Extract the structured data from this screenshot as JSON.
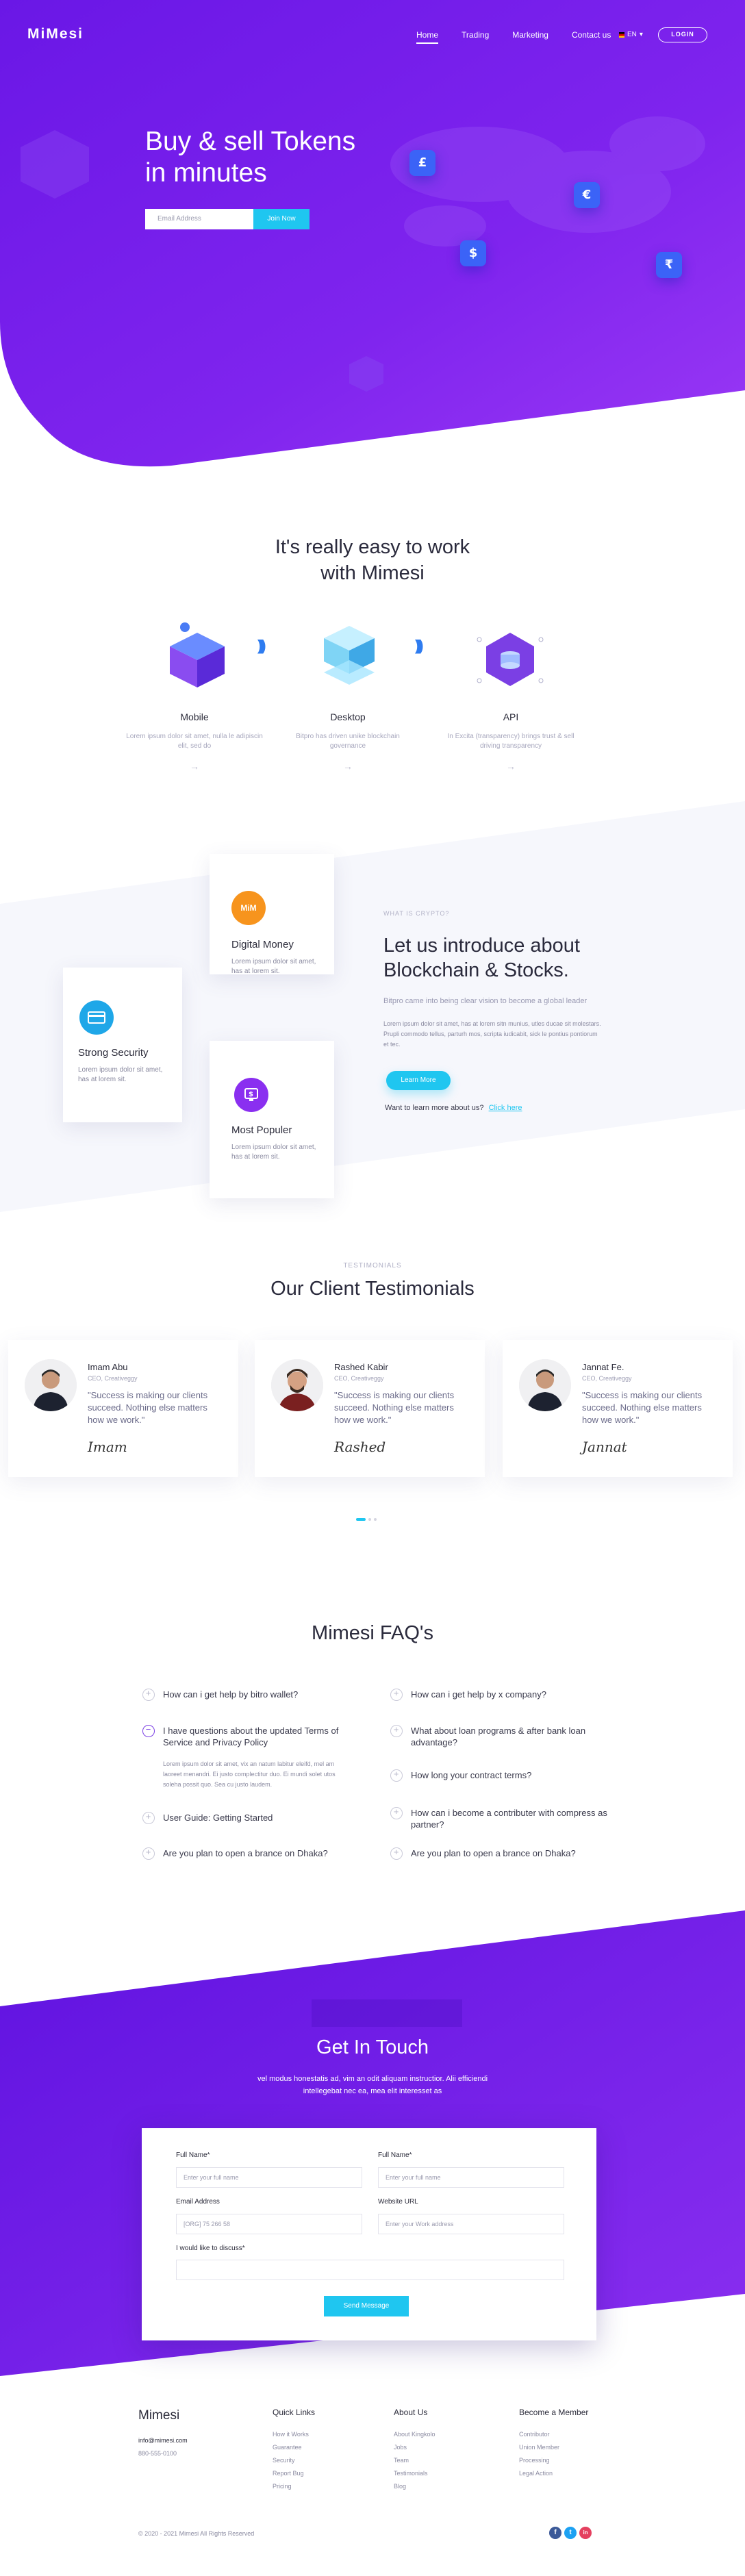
{
  "brand": {
    "logo": "MiMesi"
  },
  "nav": {
    "links": [
      "Home",
      "Trading",
      "Marketing",
      "Contact us"
    ],
    "language": "EN",
    "login": "LOGIN"
  },
  "hero": {
    "title_line1": "Buy & sell Tokens",
    "title_line2": "in minutes",
    "email_placeholder": "Email Address",
    "join_button": "Join Now",
    "coins": [
      "£",
      "€",
      "$",
      "₹"
    ]
  },
  "easy": {
    "title_line1": "It's really easy to work",
    "title_line2": "with Mimesi",
    "features": [
      {
        "name": "Mobile",
        "desc": "Lorem ipsum dolor sit amet, nulla le adipiscin elit, sed do"
      },
      {
        "name": "Desktop",
        "desc": "Bitpro has driven unike blockchain governance"
      },
      {
        "name": "API",
        "desc": "In Excita (transparency) brings trust & sell driving transparency"
      }
    ],
    "arrow": "→"
  },
  "intro": {
    "cards": [
      {
        "badge": "MiM",
        "title": "Digital Money",
        "desc": "Lorem ipsum dolor sit amet, has at lorem sit."
      },
      {
        "badge": "",
        "title": "Strong Security",
        "desc": "Lorem ipsum dolor sit amet, has at lorem sit."
      },
      {
        "badge": "",
        "title": "Most Populer",
        "desc": "Lorem ipsum dolor sit amet, has at lorem sit."
      }
    ],
    "eyebrow": "WHAT IS CRYPTO?",
    "title": "Let us introduce about Blockchain & Stocks.",
    "subtitle": "Bitpro came into being clear vision to become a global leader",
    "body": "Lorem ipsum dolor sit amet, has at lorem sitn munius, utles ducae sit molestars. Prupli commodo tellus, parturh mos, scripta iudicabit, sick le pontius pontiorum et tec.",
    "learn_button": "Learn More",
    "learn_more_text": "Want to learn more about us?",
    "learn_more_link": "Click here"
  },
  "testimonials": {
    "eyebrow": "TESTIMONIALS",
    "title": "Our Client Testimonials",
    "items": [
      {
        "name": "Imam Abu",
        "role": "CEO, Creativeggy",
        "quote": "\"Success is making our clients succeed. Nothing else matters how we work.\"",
        "signature": "Imam"
      },
      {
        "name": "Rashed Kabir",
        "role": "CEO, Creativeggy",
        "quote": "\"Success is making our clients succeed. Nothing else matters how we work.\"",
        "signature": "Rashed"
      },
      {
        "name": "Jannat Fe.",
        "role": "CEO, Creativeggy",
        "quote": "\"Success is making our clients succeed. Nothing else matters how we work.\"",
        "signature": "Jannat"
      }
    ]
  },
  "faq": {
    "title": "Mimesi FAQ's",
    "left": [
      "How can i get help by bitro wallet?",
      "I have questions about the updated Terms of Service and Privacy Policy",
      "User Guide: Getting Started",
      "Are you plan to open a brance on Dhaka?"
    ],
    "right": [
      "How can i get help by x company?",
      "What about loan programs & after bank loan advantage?",
      "How long your contract terms?",
      "How can i become a contributer with compress as partner?",
      "Are you plan to open a brance on Dhaka?"
    ],
    "open_answer": "Lorem ipsum dolor sit amet, vix an natum labitur eleifd, mel am laoreet menandri. Ei justo complectitur duo. Ei mundi solet utos soleha possit quo. Sea cu justo laudem."
  },
  "contact": {
    "title": "Get In Touch",
    "subtitle_line1": "vel modus honestatis ad, vim an odit aliquam instructior. Alii efficiendi",
    "subtitle_line2": "intellegebat nec ea, mea elit interesset as",
    "fields": {
      "full_name_label": "Full Name*",
      "full_name_placeholder": "Enter your full name",
      "full_name2_label": "Full Name*",
      "full_name2_placeholder": "Enter your full name",
      "email_label": "Email Address",
      "email_placeholder": "[ORG] 75 266 58",
      "website_label": "Website URL",
      "website_placeholder": "Enter your Work address",
      "discuss_label": "I would like to discuss*"
    },
    "send_button": "Send Message"
  },
  "footer": {
    "brand": "Mimesi",
    "email": "info@mimesi.com",
    "phone": "880-555-0100",
    "columns": [
      {
        "title": "Quick Links",
        "links": [
          "How it Works",
          "Guarantee",
          "Security",
          "Report Bug",
          "Pricing"
        ]
      },
      {
        "title": "About Us",
        "links": [
          "About Kingkolo",
          "Jobs",
          "Team",
          "Testimonials",
          "Blog"
        ]
      },
      {
        "title": "Become a Member",
        "links": [
          "Contributor",
          "Union Member",
          "Processing",
          "Legal Action"
        ]
      }
    ],
    "copyright": "© 2020 - 2021 Mimesi All Rights Reserved",
    "social": [
      "f",
      "t",
      "in"
    ]
  },
  "colors": {
    "purple": "#6d1be8",
    "violet": "#8a2ff0",
    "cyan": "#1fc6f0",
    "blue": "#3b63f7"
  }
}
